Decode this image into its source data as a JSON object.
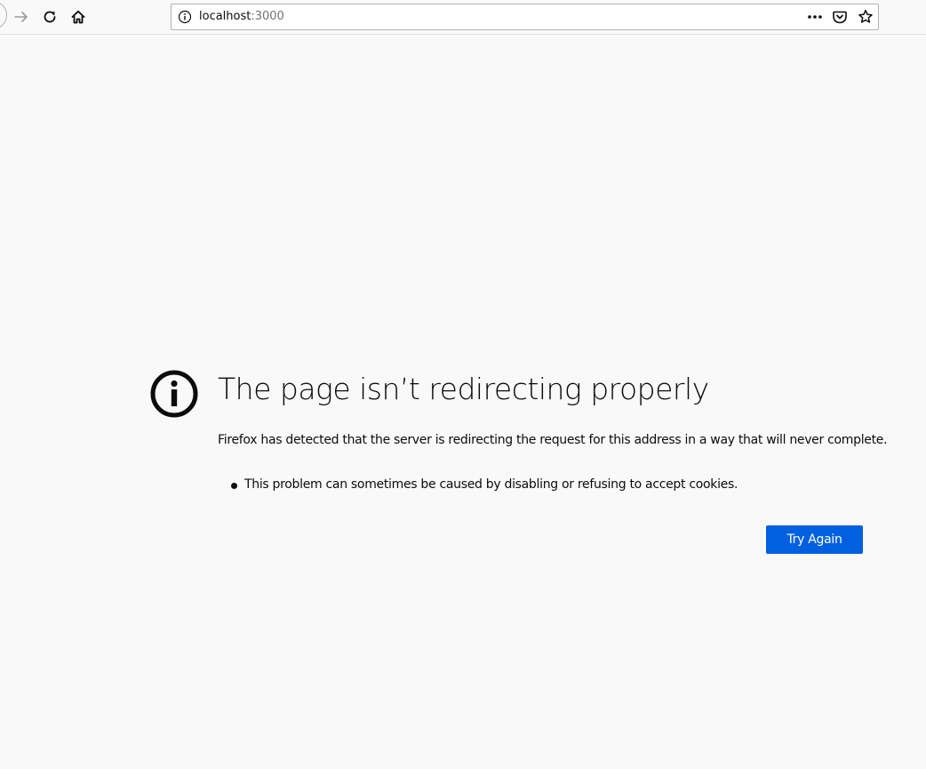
{
  "browser": {
    "url_host": "localhost",
    "url_port": ":3000",
    "nav_icons": [
      "back-icon",
      "forward-icon",
      "reload-icon",
      "home-icon"
    ],
    "url_icons": [
      "info-icon",
      "more-icon",
      "pocket-icon",
      "bookmark-star-icon"
    ]
  },
  "error": {
    "icon": "info-icon",
    "title": "The page isn’t redirecting properly",
    "description": "Firefox has detected that the server is redirecting the request for this address in a way that will never complete.",
    "reasons": [
      "This problem can sometimes be caused by disabling or refusing to accept cookies."
    ],
    "button_label": "Try Again"
  },
  "colors": {
    "page_background": "#f9f9fa",
    "button_background": "#0060df",
    "text": "#0c0c0d"
  }
}
